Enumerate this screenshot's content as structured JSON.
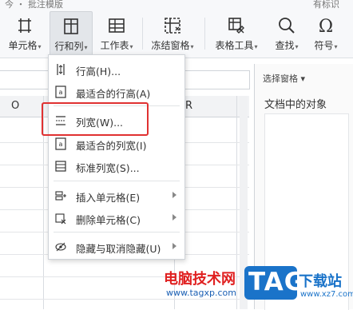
{
  "top_text": {
    "left": "今 ・ 批注模版",
    "right": "有标识"
  },
  "ribbon": {
    "buttons": [
      {
        "label": "单元格",
        "icon": "cell-icon"
      },
      {
        "label": "行和列",
        "icon": "row-column-icon",
        "active": true
      },
      {
        "label": "工作表",
        "icon": "worksheet-icon"
      },
      {
        "label": "冻结窗格",
        "icon": "freeze-panes-icon"
      },
      {
        "label": "表格工具",
        "icon": "table-tools-icon"
      },
      {
        "label": "查找",
        "icon": "search-icon"
      },
      {
        "label": "符号",
        "icon": "omega-symbol-icon"
      }
    ]
  },
  "grid": {
    "columns": [
      "O",
      "R"
    ]
  },
  "side_pane": {
    "header": "选择窗格",
    "title": "文档中的对象"
  },
  "menu": {
    "items": [
      {
        "label": "行高(H)...",
        "icon": "row-height-icon",
        "submenu": false
      },
      {
        "label": "最适合的行高(A)",
        "icon": "autofit-row-height-icon",
        "submenu": false
      },
      {
        "label": "列宽(W)...",
        "icon": "column-width-icon",
        "submenu": false,
        "highlighted": true
      },
      {
        "label": "最适合的列宽(I)",
        "icon": "autofit-column-width-icon",
        "submenu": false
      },
      {
        "label": "标准列宽(S)...",
        "icon": "standard-column-width-icon",
        "submenu": false
      },
      {
        "label": "插入单元格(E)",
        "icon": "insert-cells-icon",
        "submenu": true
      },
      {
        "label": "删除单元格(C)",
        "icon": "delete-cells-icon",
        "submenu": true
      },
      {
        "label": "隐藏与取消隐藏(U)",
        "icon": "hide-unhide-icon",
        "submenu": true
      }
    ]
  },
  "watermark": {
    "site_name": "电脑技术网",
    "url": "www.tagxp.com",
    "logo": "TAG",
    "suffix": "下载站",
    "suffix_url": "www.xz7.com"
  },
  "colors": {
    "highlight": "#e03131",
    "menu_border": "#cfd3d8",
    "tag_blue": "#1a73c9"
  }
}
